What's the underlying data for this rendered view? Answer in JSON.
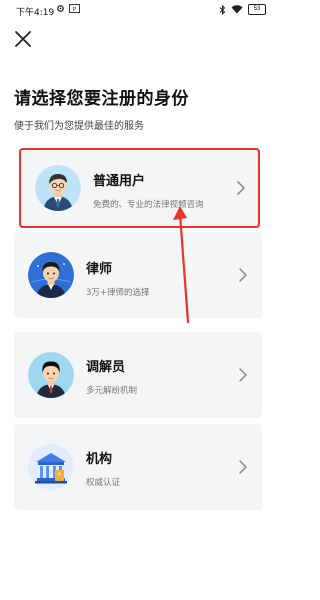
{
  "status_bar": {
    "time": "下午4:19",
    "battery": "53"
  },
  "page": {
    "title": "请选择您要注册的身份",
    "subtitle": "便于我们为您提供最佳的服务"
  },
  "options": [
    {
      "title": "普通用户",
      "desc": "免费的、专业的法律视频咨询",
      "icon": "user-avatar-icon"
    },
    {
      "title": "律师",
      "desc": "3万+律师的选择",
      "icon": "lawyer-avatar-icon"
    },
    {
      "title": "调解员",
      "desc": "多元解纷机制",
      "icon": "mediator-avatar-icon"
    },
    {
      "title": "机构",
      "desc": "权威认证",
      "icon": "institution-building-icon"
    }
  ],
  "colors": {
    "highlight": "#e8322d",
    "card_bg": "#f4f5f7"
  }
}
